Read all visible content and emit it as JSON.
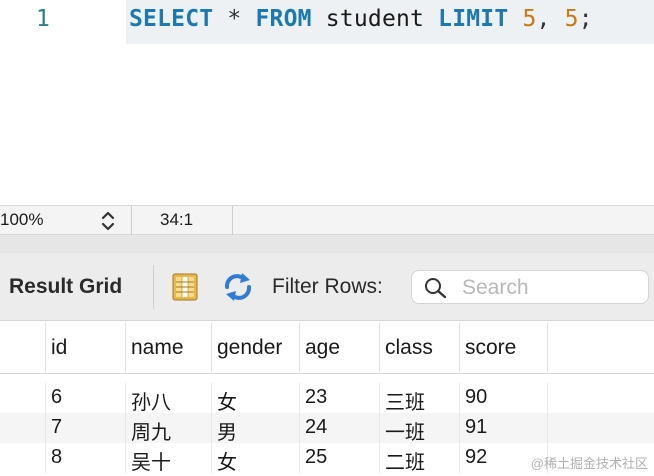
{
  "editor": {
    "line_number": "1",
    "tokens": {
      "select": "SELECT",
      "star": "*",
      "from": "FROM",
      "table": "student",
      "limit": "LIMIT",
      "offset": "5",
      "comma": ",",
      "count": "5",
      "semicolon": ";"
    }
  },
  "status_bar": {
    "zoom": "100%",
    "cursor_position": "34:1"
  },
  "toolbar": {
    "result_grid_label": "Result Grid",
    "filter_rows_label": "Filter Rows:",
    "search_placeholder": "Search"
  },
  "grid": {
    "columns": [
      "id",
      "name",
      "gender",
      "age",
      "class",
      "score"
    ],
    "rows": [
      [
        "6",
        "孙八",
        "女",
        "23",
        "三班",
        "90"
      ],
      [
        "7",
        "周九",
        "男",
        "24",
        "一班",
        "91"
      ],
      [
        "8",
        "吴十",
        "女",
        "25",
        "二班",
        "92"
      ]
    ]
  },
  "watermark": "@稀土掘金技术社区",
  "icons": {
    "zoom_stepper": "chevron-up-down-icon",
    "result_grid": "grid-view-icon",
    "refresh": "refresh-icon",
    "search": "search-icon"
  },
  "colors": {
    "keyword": "#1a78b4",
    "number": "#c87a10",
    "line_number": "#2a7f8f",
    "current_line_bg": "#eef1f3"
  }
}
